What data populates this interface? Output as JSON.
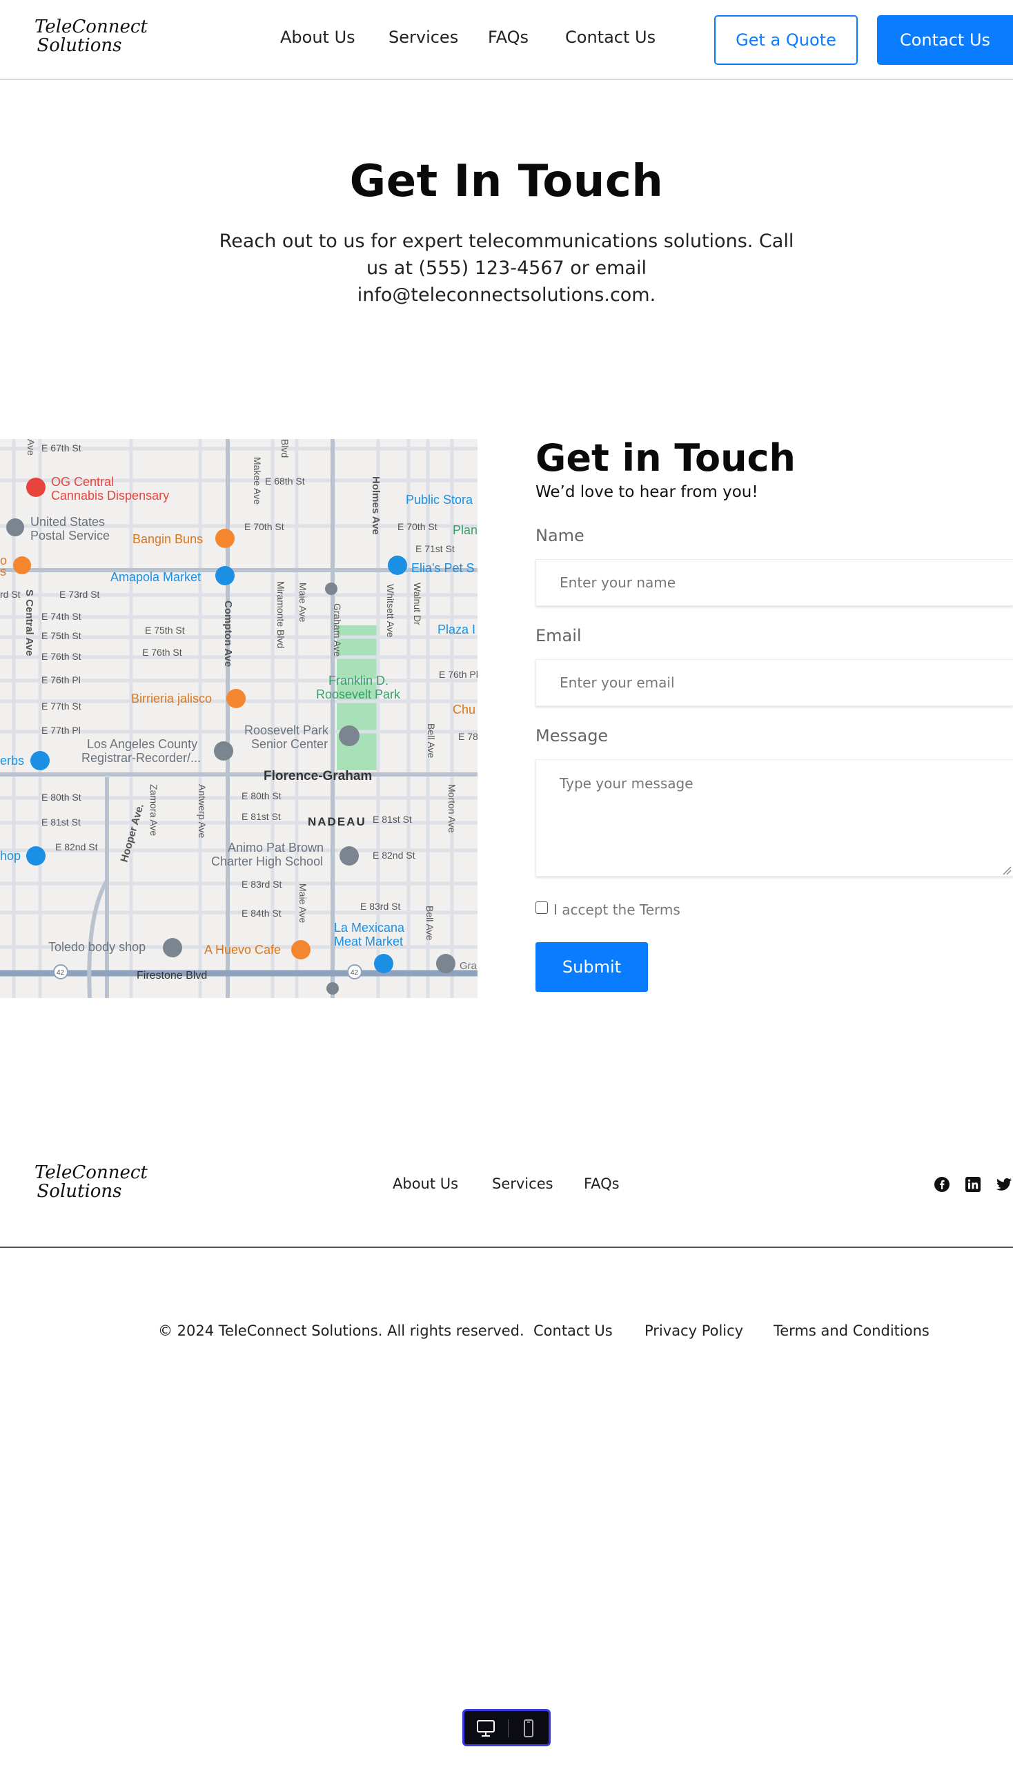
{
  "header": {
    "logo_line1": "TeleConnect",
    "logo_line2": "Solutions",
    "nav": [
      "About Us",
      "Services",
      "FAQs",
      "Contact Us"
    ],
    "quote_button": "Get a Quote",
    "contact_button": "Contact Us"
  },
  "hero": {
    "title": "Get In Touch",
    "text": "Reach out to us for expert telecommunications solutions. Call us at (555) 123-4567 or email info@teleconnectsolutions.com."
  },
  "map": {
    "labels": {
      "e67": "E 67th St",
      "e68": "E 68th St",
      "og1": "OG Central",
      "og2": "Cannabis Dispensary",
      "usps1": "United States",
      "usps2": "Postal Service",
      "bangin": "Bangin Buns",
      "e70a": "E 70th St",
      "e70b": "E 70th St",
      "public": "Public Stora",
      "e71": "E 71st St",
      "elias": "Elia's Pet S",
      "plan": "Plan",
      "amapola": "Amapola Market",
      "e73": "E 73rd St",
      "rd": "rd St",
      "e74": "E 74th St",
      "e75a": "E 75th St",
      "e75b": "E 75th St",
      "e76a": "E 76th St",
      "e76b": "E 76th St",
      "e76pl": "E 76th Pl",
      "e76pl2": "E 76th Pl",
      "plaza": "Plaza I",
      "franklin1": "Franklin D.",
      "franklin2": "Roosevelt Park",
      "birria": "Birrieria jalisco",
      "chu": "Chu",
      "e77": "E 77th St",
      "e77pl": "E 77th Pl",
      "e78": "E 78",
      "roos1": "Roosevelt Park",
      "roos2": "Senior Center",
      "la1": "Los Angeles County",
      "la2": "Registrar-Recorder/...",
      "erbs": "erbs",
      "florence": "Florence-Graham",
      "e80": "E 80th St",
      "e80b": "E 80th St",
      "e81": "E 81st St",
      "e81b": "E 81st St",
      "e81c": "E 81st St",
      "nadeau": "NADEAU",
      "e82": "E 82nd St",
      "e82b": "E 82nd St",
      "animo1": "Animo Pat Brown",
      "animo2": "Charter High School",
      "e83": "E 83rd St",
      "e83b": "E 83rd St",
      "e84": "E 84th St",
      "hop": "hop",
      "toledo": "Toledo body shop",
      "huevo": "A Huevo Cafe",
      "mexicana1": "La Mexicana",
      "mexicana2": "Meat Market",
      "firestone": "Firestone Blvd",
      "gra": "Gra",
      "makee": "Makee Ave",
      "holmes": "Holmes Ave",
      "whitsett": "Whitsett Ave",
      "walnut": "Walnut Dr",
      "miramonte": "Miramonte Blvd",
      "maie": "Maie Ave",
      "graham": "Graham Ave",
      "compton": "Compton Ave",
      "central": "S Central Ave",
      "hooper": "Hooper Ave.",
      "zamora": "Zamora Ave",
      "antwerp": "Antwerp Ave",
      "maie2": "Maie Ave",
      "bell": "Bell Ave",
      "bell2": "Bell Ave",
      "morton": "Morton Ave",
      "blvd": "Blvd",
      "ave": "Ave",
      "o": "o",
      "s": "s",
      "r42a": "42",
      "r42b": "42"
    }
  },
  "form": {
    "title": "Get in Touch",
    "subtitle": "We’d love to hear from you!",
    "name_label": "Name",
    "name_placeholder": "Enter your name",
    "email_label": "Email",
    "email_placeholder": "Enter your email",
    "message_label": "Message",
    "message_placeholder": "Type your message",
    "terms_label": "I accept the Terms",
    "submit": "Submit"
  },
  "footer": {
    "logo_line1": "TeleConnect",
    "logo_line2": "Solutions",
    "nav": [
      "About Us",
      "Services",
      "FAQs"
    ],
    "copyright": "© 2024 TeleConnect Solutions. All rights reserved.",
    "links": [
      "Contact Us",
      "Privacy Policy",
      "Terms and Conditions"
    ],
    "social_icons": [
      "facebook-icon",
      "linkedin-icon",
      "twitter-icon"
    ]
  },
  "device_switcher": {
    "icons": [
      "desktop-icon",
      "mobile-icon"
    ]
  },
  "colors": {
    "accent": "#0a7cff",
    "map_background": "#f1f0ee",
    "park": "#a8e0b8",
    "poi_orange": "#f3862e",
    "poi_blue": "#1a8fe3",
    "poi_red": "#e8443e",
    "poi_gray": "#7b8590"
  }
}
